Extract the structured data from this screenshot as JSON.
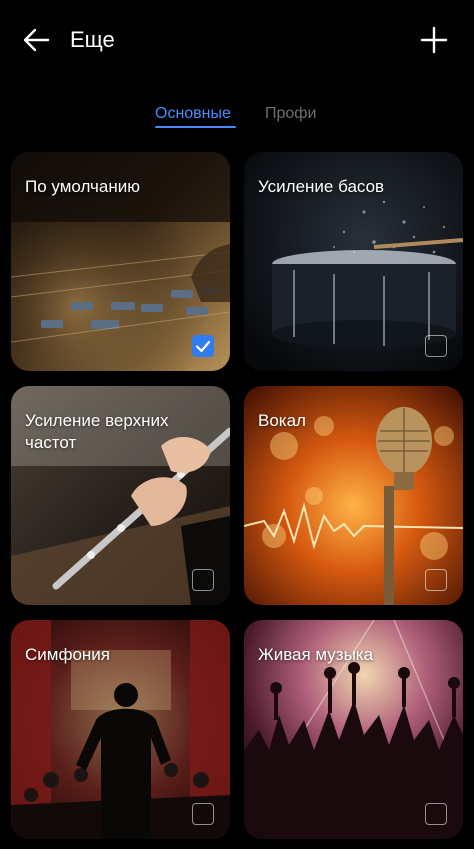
{
  "header": {
    "title": "Еще",
    "back_icon": "arrow-left-icon",
    "add_icon": "plus-icon"
  },
  "tabs": [
    {
      "label": "Основные",
      "active": true
    },
    {
      "label": "Профи",
      "active": false
    }
  ],
  "colors": {
    "accent": "#4a8cff",
    "background": "#000000",
    "checkbox_on": "#2f7bf2"
  },
  "effects": [
    {
      "label": "По умолчанию",
      "selected": true
    },
    {
      "label": "Усиление басов",
      "selected": false
    },
    {
      "label": "Усиление верхних частот",
      "selected": false
    },
    {
      "label": "Вокал",
      "selected": false
    },
    {
      "label": "Симфония",
      "selected": false
    },
    {
      "label": "Живая музыка",
      "selected": false
    }
  ]
}
